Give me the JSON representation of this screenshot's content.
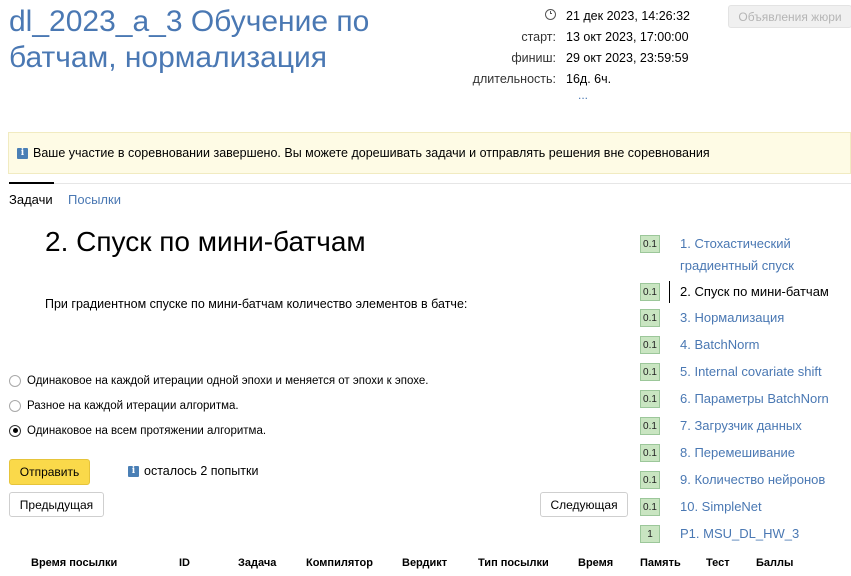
{
  "contest": {
    "title": "dl_2023_a_3 Обучение по батчам, нормализация"
  },
  "meta": {
    "current_time": "21 дек 2023, 14:26:32",
    "start_label": "старт:",
    "start": "13 окт 2023, 17:00:00",
    "finish_label": "финиш:",
    "finish": "29 окт 2023, 23:59:59",
    "duration_label": "длительность:",
    "duration": "16д. 6ч.",
    "more": "..."
  },
  "jury_button": "Объявления жюри",
  "notice": {
    "icon": "i",
    "text": "Ваше участие в соревновании завершено. Вы можете дорешивать задачи и отправлять решения вне соревнования"
  },
  "tabs": {
    "problems": "Задачи",
    "submissions": "Посылки"
  },
  "problem": {
    "title": "2. Спуск по мини-батчам",
    "statement": "При градиентном спуске по мини-батчам количество элементов в батче:",
    "options": [
      {
        "label": "Одинаковое на каждой итерации одной эпохи и меняется от эпохи к эпохе.",
        "checked": false
      },
      {
        "label": "Разное на каждой итерации алгоритма.",
        "checked": false
      },
      {
        "label": "Одинаковое на всем протяжении алгоритма.",
        "checked": true
      }
    ],
    "submit_label": "Отправить",
    "attempts_icon": "i",
    "attempts_text": "осталось 2 попытки",
    "prev_label": "Предыдущая",
    "next_label": "Следующая"
  },
  "submissions_table": {
    "headers": [
      "Время посылки",
      "ID",
      "Задача",
      "Компилятор",
      "Вердикт",
      "Тип посылки",
      "Время",
      "Память",
      "Тест",
      "Баллы"
    ]
  },
  "problem_list": [
    {
      "score": "0.1",
      "label": "1. Стохастический градиентный спуск",
      "current": false
    },
    {
      "score": "0.1",
      "label": "2. Спуск по мини-батчам",
      "current": true
    },
    {
      "score": "0.1",
      "label": "3. Нормализация",
      "current": false
    },
    {
      "score": "0.1",
      "label": "4. BatchNorm",
      "current": false
    },
    {
      "score": "0.1",
      "label": "5. Internal covariate shift",
      "current": false
    },
    {
      "score": "0.1",
      "label": "6. Параметры BatchNorn",
      "current": false
    },
    {
      "score": "0.1",
      "label": "7. Загрузчик данных",
      "current": false
    },
    {
      "score": "0.1",
      "label": "8. Перемешивание",
      "current": false
    },
    {
      "score": "0.1",
      "label": "9. Количество нейронов",
      "current": false
    },
    {
      "score": "0.1",
      "label": "10. SimpleNet",
      "current": false
    },
    {
      "score": "1",
      "label": "P1. MSU_DL_HW_3",
      "current": false
    }
  ],
  "colors": {
    "link": "#4a78b3",
    "accent_button": "#fad94a",
    "notice_bg": "#fefbe5",
    "score_bg": "#c9e5c1"
  }
}
